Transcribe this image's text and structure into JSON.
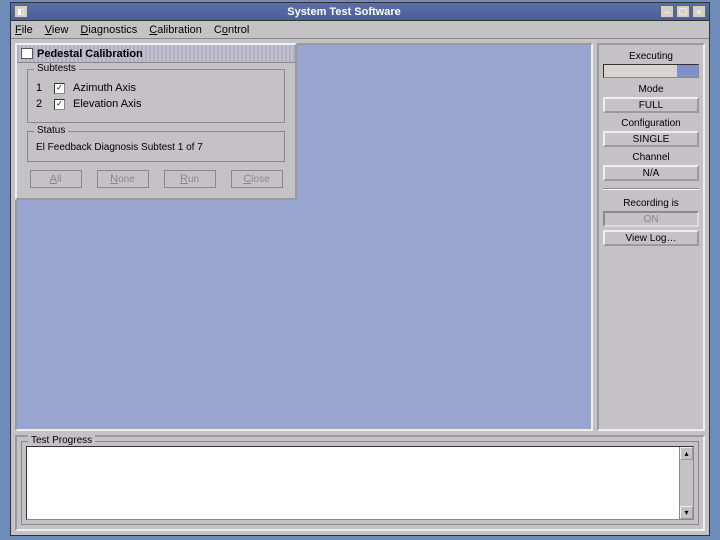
{
  "window": {
    "title": "System Test Software"
  },
  "menu": {
    "file": "File",
    "view": "View",
    "diagnostics": "Diagnostics",
    "calibration": "Calibration",
    "control": "Control"
  },
  "right": {
    "executing": "Executing",
    "mode_label": "Mode",
    "mode_value": "FULL",
    "config_label": "Configuration",
    "config_value": "SINGLE",
    "channel_label": "Channel",
    "channel_value": "N/A",
    "recording_label": "Recording is",
    "recording_value": "ON",
    "viewlog": "View Log…"
  },
  "dialog": {
    "title": "Pedestal Calibration",
    "subtests_legend": "Subtests",
    "subtests": [
      {
        "num": "1",
        "label": "Azimuth Axis",
        "checked": true
      },
      {
        "num": "2",
        "label": "Elevation Axis",
        "checked": true
      }
    ],
    "status_legend": "Status",
    "status_text": "El Feedback Diagnosis Subtest 1 of 7",
    "buttons": {
      "all": "All",
      "none": "None",
      "run": "Run",
      "close": "Close"
    }
  },
  "bottom": {
    "legend": "Test Progress"
  }
}
